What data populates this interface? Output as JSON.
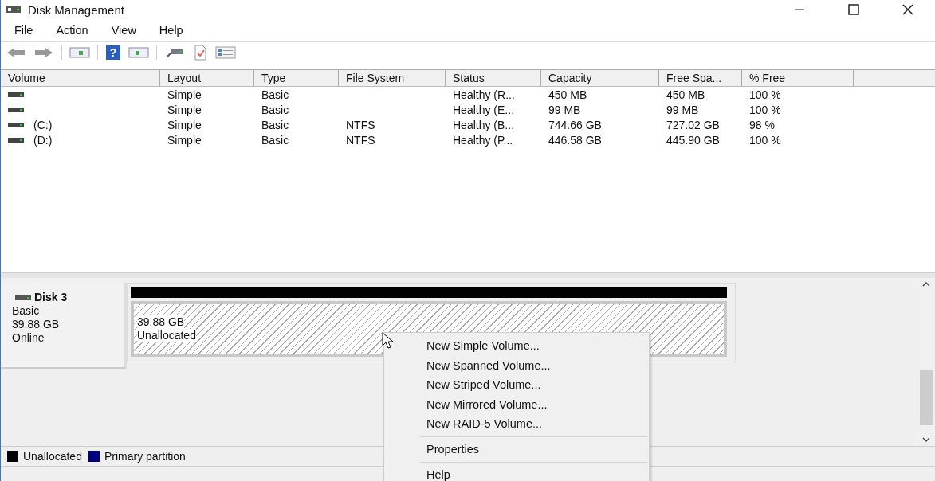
{
  "window": {
    "title": "Disk Management"
  },
  "menu_bar": [
    "File",
    "Action",
    "View",
    "Help"
  ],
  "toolbar": {
    "help_glyph": "?"
  },
  "table": {
    "columns": [
      "Volume",
      "Layout",
      "Type",
      "File System",
      "Status",
      "Capacity",
      "Free Spa...",
      "% Free"
    ],
    "rows": [
      {
        "volume": "",
        "layout": "Simple",
        "type": "Basic",
        "file_system": "",
        "status": "Healthy (R...",
        "capacity": "450 MB",
        "free_space": "450 MB",
        "percent_free": "100 %"
      },
      {
        "volume": "",
        "layout": "Simple",
        "type": "Basic",
        "file_system": "",
        "status": "Healthy (E...",
        "capacity": "99 MB",
        "free_space": "99 MB",
        "percent_free": "100 %"
      },
      {
        "volume": "(C:)",
        "layout": "Simple",
        "type": "Basic",
        "file_system": "NTFS",
        "status": "Healthy (B...",
        "capacity": "744.66 GB",
        "free_space": "727.02 GB",
        "percent_free": "98 %"
      },
      {
        "volume": "(D:)",
        "layout": "Simple",
        "type": "Basic",
        "file_system": "NTFS",
        "status": "Healthy (P...",
        "capacity": "446.58 GB",
        "free_space": "445.90 GB",
        "percent_free": "100 %"
      }
    ]
  },
  "disk": {
    "name": "Disk 3",
    "type": "Basic",
    "size": "39.88 GB",
    "state": "Online",
    "partitions": [
      {
        "size": "39.88 GB",
        "label": "Unallocated",
        "color": "#000000"
      }
    ]
  },
  "legend": [
    {
      "label": "Unallocated",
      "color": "#000000"
    },
    {
      "label": "Primary partition",
      "color": "#000080"
    }
  ],
  "context_menu": {
    "groups": [
      [
        "New Simple Volume...",
        "New Spanned Volume...",
        "New Striped Volume...",
        "New Mirrored Volume...",
        "New RAID-5 Volume..."
      ],
      [
        "Properties"
      ],
      [
        "Help"
      ]
    ]
  }
}
